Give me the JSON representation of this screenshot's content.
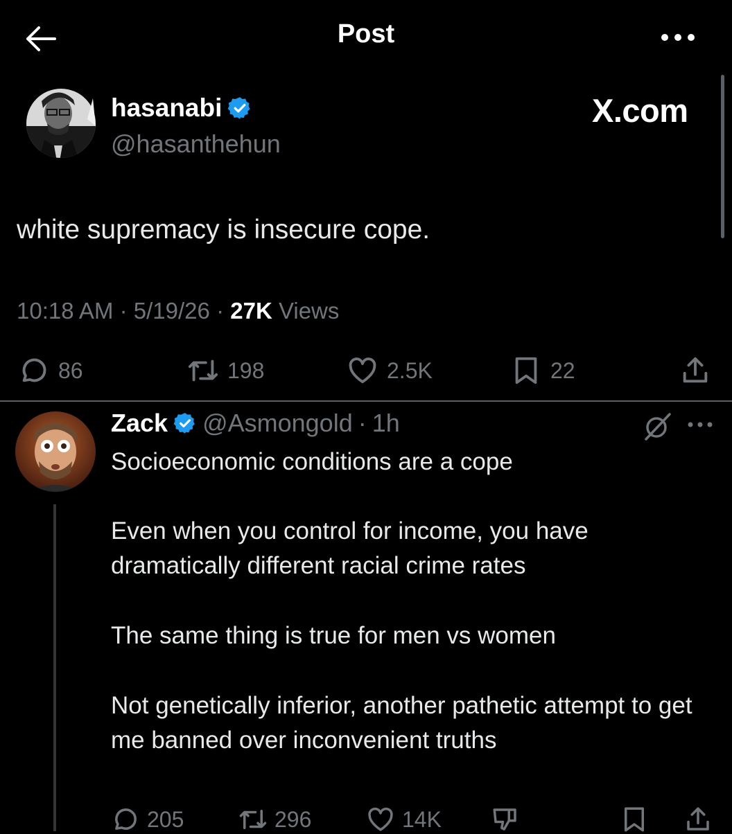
{
  "header": {
    "title": "Post"
  },
  "post": {
    "author_name": "hasanabi",
    "author_handle": "@hasanthehun",
    "watermark": "X.com",
    "text": "white supremacy is insecure cope.",
    "time": "10:18 AM",
    "date": "5/19/26",
    "views_count": "27K",
    "views_label": "Views",
    "separator": "·",
    "actions": {
      "replies": "86",
      "reposts": "198",
      "likes": "2.5K",
      "bookmarks": "22"
    }
  },
  "reply": {
    "author_name": "Zack",
    "author_handle": "@Asmongold",
    "separator": "·",
    "age": "1h",
    "paragraphs": [
      "Socioeconomic conditions are a cope",
      "Even when you control for income, you have dramatically different racial crime rates",
      "The same thing is true for men vs women",
      "Not genetically inferior, another pathetic attempt to get me banned over inconvenient truths"
    ],
    "actions": {
      "replies": "205",
      "reposts": "296",
      "likes": "14K"
    }
  },
  "colors": {
    "background": "#000000",
    "text_primary": "#e7e9ea",
    "text_secondary": "#71767b",
    "verified_badge": "#1d9bf0",
    "divider": "#5a5e63"
  },
  "icons": {
    "back": "arrow-left-icon",
    "more": "more-horizontal-icon",
    "verified": "verified-badge-icon",
    "reply": "reply-bubble-icon",
    "repost": "repost-icon",
    "like": "heart-icon",
    "bookmark": "bookmark-icon",
    "share": "share-icon",
    "grok": "grok-icon",
    "downvote": "thumbs-down-icon"
  }
}
